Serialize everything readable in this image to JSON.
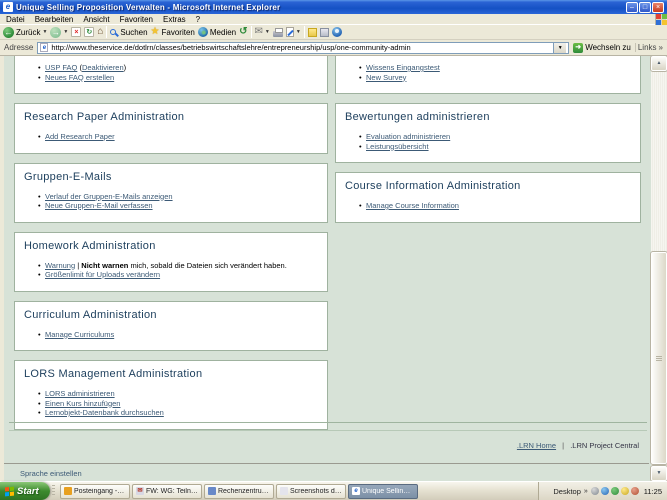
{
  "colors": {
    "chrome": "#ECE9D8",
    "sage": "#D7E2D7",
    "box-border": "#9FB29F",
    "header": "#1C3E5C",
    "link": "#3C5A76"
  },
  "window": {
    "title": "Unique Selling Proposition Verwalten - Microsoft Internet Explorer",
    "minimize": "–",
    "restore": "□",
    "close": "×"
  },
  "menubar": {
    "items": [
      "Datei",
      "Bearbeiten",
      "Ansicht",
      "Favoriten",
      "Extras",
      "?"
    ]
  },
  "toolbar": {
    "back": "Zurück",
    "search": "Suchen",
    "favorites": "Favoriten",
    "media": "Medien"
  },
  "addressbar": {
    "label": "Adresse",
    "url": "http://www.theservice.de/dotlrn/classes/betriebswirtschaftslehre/entrepreneurship/usp/one-community-admin",
    "go": "Wechseln zu",
    "links": "Links",
    "links_chevron": "»"
  },
  "content": {
    "left_boxes": [
      {
        "header": null,
        "clipped": true,
        "items": [
          [
            {
              "text": "USP FAQ",
              "style": "link"
            },
            {
              "text": " (",
              "style": "plain"
            },
            {
              "text": "Deaktivieren",
              "style": "link"
            },
            {
              "text": ")",
              "style": "plain"
            }
          ],
          [
            {
              "text": "Neues FAQ erstellen",
              "style": "link"
            }
          ]
        ]
      },
      {
        "header": "Research Paper Administration",
        "clipped": false,
        "items": [
          [
            {
              "text": "Add Research Paper",
              "style": "link"
            }
          ]
        ]
      },
      {
        "header": "Gruppen-E-Mails",
        "clipped": false,
        "items": [
          [
            {
              "text": "Verlauf der Gruppen-E-Mails anzeigen",
              "style": "link"
            }
          ],
          [
            {
              "text": "Neue Gruppen-E-Mail verfassen",
              "style": "link"
            }
          ]
        ]
      },
      {
        "header": "Homework Administration",
        "clipped": false,
        "items": [
          [
            {
              "text": "Warnung",
              "style": "link"
            },
            {
              "text": " | ",
              "style": "plain"
            },
            {
              "text": "Nicht warnen",
              "style": "bold"
            },
            {
              "text": " mich, sobald die Dateien sich verändert haben.",
              "style": "plain"
            }
          ],
          [
            {
              "text": "Größenlimit für Uploads verändern",
              "style": "link"
            }
          ]
        ]
      },
      {
        "header": "Curriculum Administration",
        "clipped": false,
        "items": [
          [
            {
              "text": "Manage Curriculums",
              "style": "link"
            }
          ]
        ]
      },
      {
        "header": "LORS Management Administration",
        "clipped": false,
        "items": [
          [
            {
              "text": "LORS administrieren",
              "style": "link"
            }
          ],
          [
            {
              "text": "Einen Kurs hinzufügen",
              "style": "link"
            }
          ],
          [
            {
              "text": "Lernobjekt-Datenbank durchsuchen",
              "style": "link"
            }
          ]
        ]
      }
    ],
    "right_boxes": [
      {
        "header": null,
        "clipped": true,
        "items": [
          [
            {
              "text": "Wissens Eingangstest",
              "style": "link"
            }
          ],
          [
            {
              "text": "New Survey",
              "style": "link"
            }
          ]
        ]
      },
      {
        "header": "Bewertungen administrieren",
        "clipped": false,
        "items": [
          [
            {
              "text": "Evaluation administrieren",
              "style": "link"
            }
          ],
          [
            {
              "text": "Leistungsübersicht",
              "style": "link"
            }
          ]
        ]
      },
      {
        "header": "Course Information Administration",
        "clipped": false,
        "items": [
          [
            {
              "text": "Manage Course Information",
              "style": "link"
            }
          ]
        ]
      }
    ],
    "footer": {
      "home_link": ".LRN Home",
      "separator": "|",
      "project_link": ".LRN Project Central",
      "language_link": "Sprache einstellen"
    }
  },
  "taskbar": {
    "start": "Start",
    "tasks": [
      {
        "label": "Posteingang - Micros...",
        "icon": "outlook",
        "active": false
      },
      {
        "label": "FW: WG: Teilnahme v...",
        "icon": "mail",
        "active": false
      },
      {
        "label": "Rechenzentrum Uni K...",
        "icon": "window",
        "active": false
      },
      {
        "label": "Screenshots dotLRN...",
        "icon": "image",
        "active": false
      },
      {
        "label": "Unique Selling Propos...",
        "icon": "ie",
        "active": true
      }
    ],
    "tray": {
      "desktop_label": "Desktop",
      "chevron": "»",
      "icons": [
        "clock",
        "network",
        "messenger",
        "volume",
        "update"
      ],
      "clock": "11:25"
    }
  }
}
